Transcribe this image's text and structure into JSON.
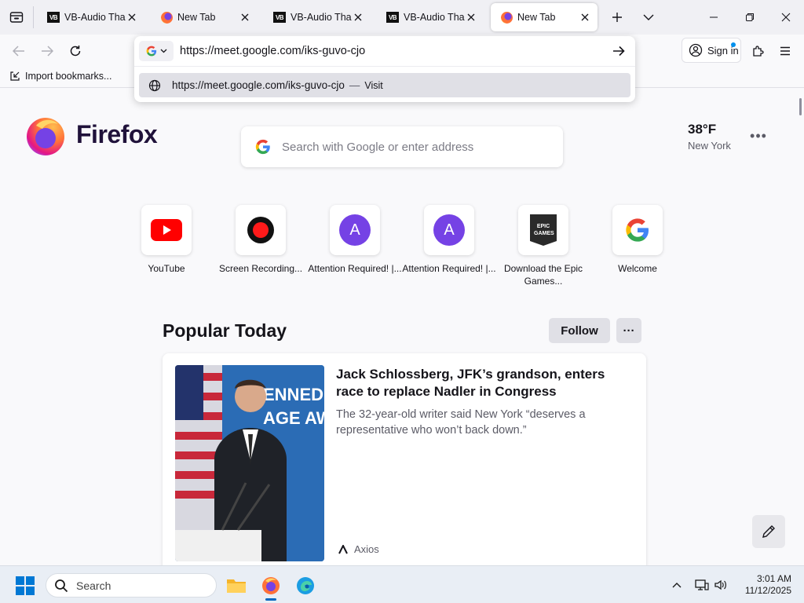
{
  "tabs": [
    {
      "title": "VB-Audio Thank",
      "icon": "vb-audio-icon",
      "active": false
    },
    {
      "title": "New Tab",
      "icon": "firefox-icon",
      "active": false
    },
    {
      "title": "VB-Audio Thank",
      "icon": "vb-audio-icon",
      "active": false
    },
    {
      "title": "VB-Audio Thank",
      "icon": "vb-audio-icon",
      "active": false
    },
    {
      "title": "New Tab",
      "icon": "firefox-icon",
      "active": true
    }
  ],
  "toolbar": {
    "signin_label": "Sign in",
    "bookmarks_import_label": "Import bookmarks..."
  },
  "urlbar": {
    "value": "https://meet.google.com/iks-guvo-cjo",
    "suggestion_url": "https://meet.google.com/iks-guvo-cjo",
    "suggestion_separator": "—",
    "suggestion_action": "Visit"
  },
  "newtab": {
    "brand": "Firefox",
    "search_placeholder": "Search with Google or enter address",
    "weather": {
      "temp": "38°F",
      "city": "New York"
    },
    "shortcuts": [
      {
        "label": "YouTube",
        "icon": "youtube-icon"
      },
      {
        "label": "Screen Recording...",
        "icon": "record-icon"
      },
      {
        "label": "Attention Required! |...",
        "icon": "letter-a-icon",
        "letter": "A"
      },
      {
        "label": "Attention Required! |...",
        "icon": "letter-a-icon",
        "letter": "A"
      },
      {
        "label": "Download the Epic Games...",
        "icon": "epic-games-icon",
        "logo_text": "EPIC GAMES"
      },
      {
        "label": "Welcome",
        "icon": "google-icon"
      }
    ],
    "popular_title": "Popular Today",
    "follow_label": "Follow",
    "story": {
      "headline": "Jack Schlossberg, JFK’s grandson, enters race to replace Nadler in Congress",
      "excerpt": "The 32-year-old writer said New York “deserves a representative who won’t back down.”",
      "source": "Axios"
    }
  },
  "taskbar": {
    "search_label": "Search",
    "time": "3:01 AM",
    "date": "11/12/2025"
  },
  "colors": {
    "accent": "#0078d4",
    "firefox_purple": "#20123a",
    "youtube_red": "#ff0000"
  }
}
